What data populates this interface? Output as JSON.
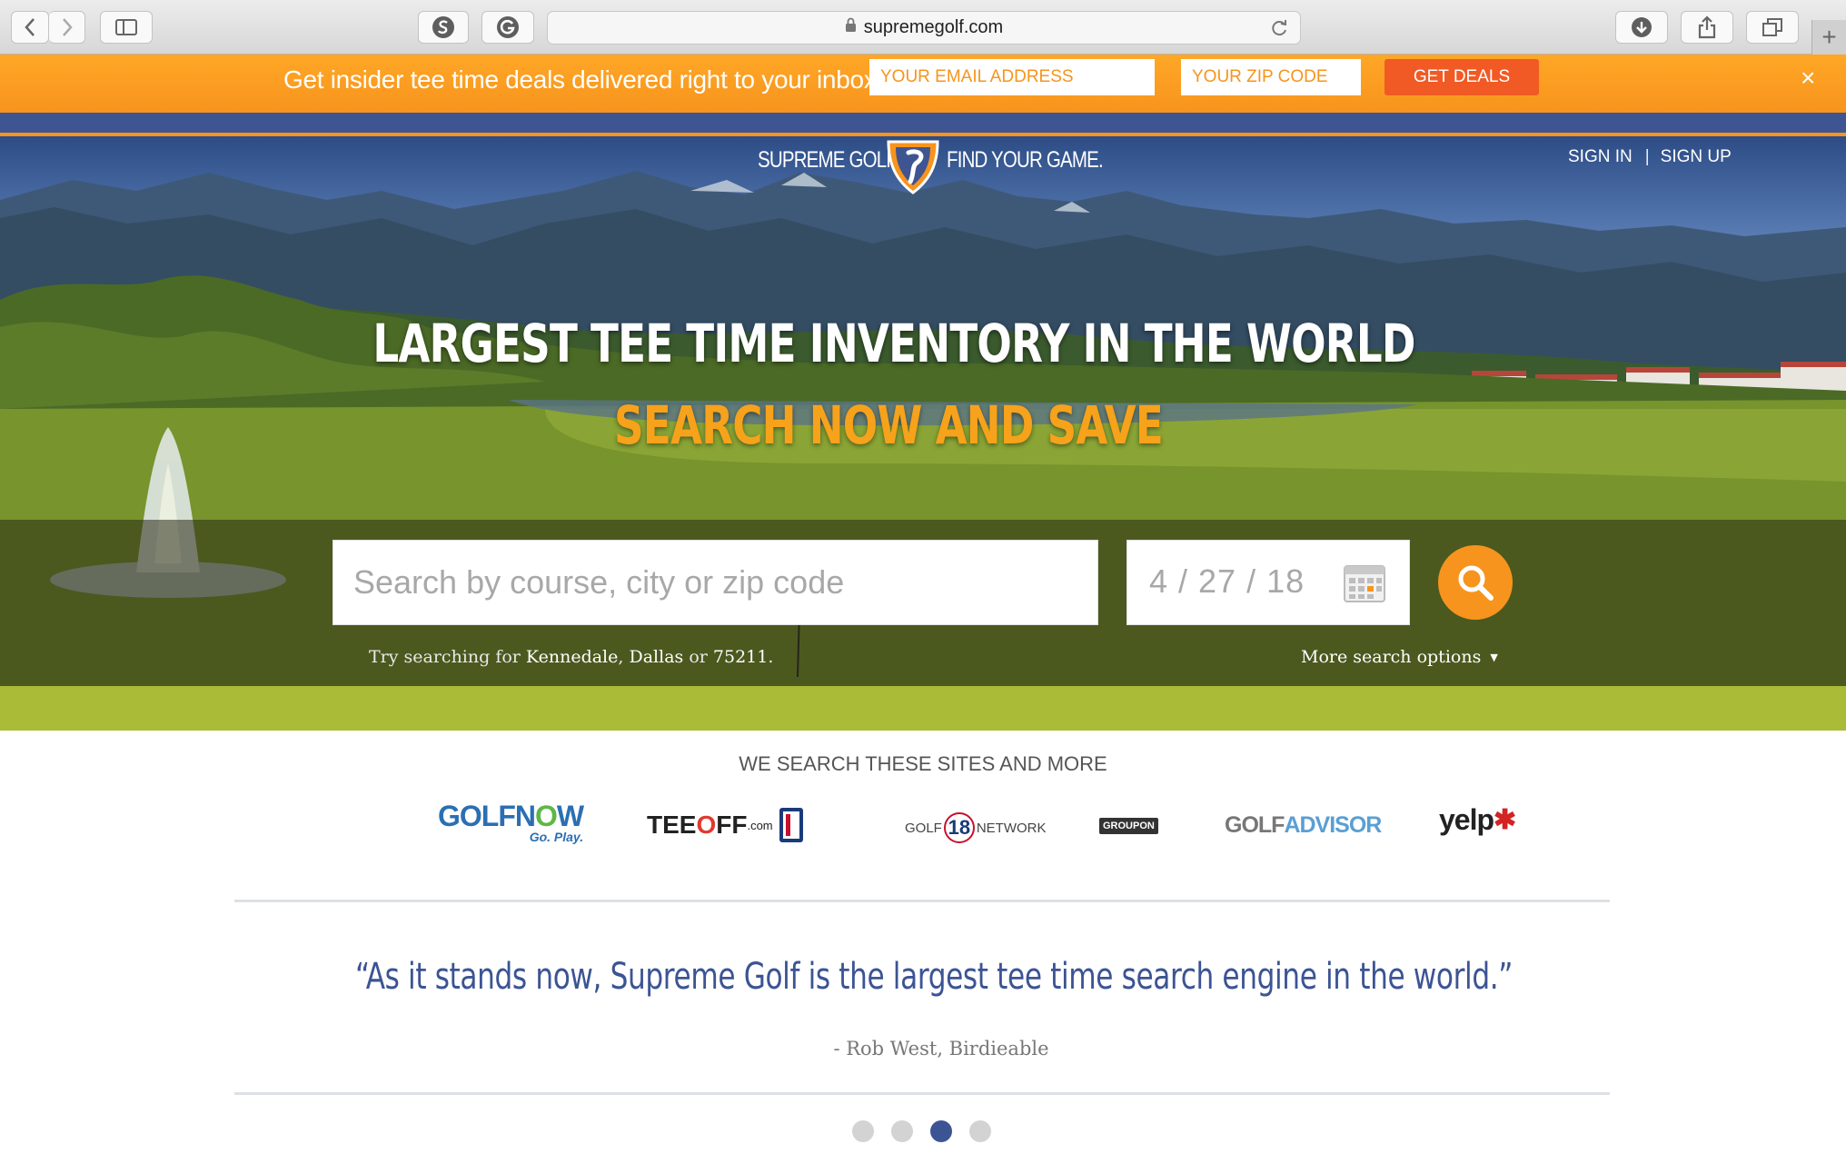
{
  "browser": {
    "url": "supremegolf.com"
  },
  "promo": {
    "text": "Get insider tee time deals delivered right to your inbox!",
    "email_placeholder": "YOUR EMAIL ADDRESS",
    "zip_placeholder": "YOUR ZIP CODE",
    "button_label": "GET DEALS",
    "close_glyph": "×"
  },
  "header": {
    "brand_left": "SUPREME GOLF",
    "brand_right": "FIND YOUR GAME.",
    "sign_in": "SIGN IN",
    "separator": "|",
    "sign_up": "SIGN UP"
  },
  "hero": {
    "title": "LARGEST TEE TIME INVENTORY IN THE WORLD",
    "subtitle": "SEARCH NOW AND SAVE",
    "search_placeholder": "Search by course, city or zip code",
    "date_value": "4 / 27 / 18",
    "hint_prefix": "Try searching for ",
    "hint_items": [
      "Kennedale",
      "Dallas",
      "75211"
    ],
    "hint_joiners": [
      ", ",
      " or ",
      "."
    ],
    "more_options": "More search options"
  },
  "partners": {
    "heading": "WE SEARCH THESE SITES AND MORE",
    "logos": {
      "golfnow_a": "GOLFN",
      "golfnow_b": "O",
      "golfnow_c": "W",
      "golfnow_tag": "Go. Play.",
      "teeoff_a": "TEE",
      "teeoff_o": "O",
      "teeoff_b": "FF",
      "teeoff_com": ".com",
      "golf18_a": "GOLF",
      "golf18_num": "18",
      "golf18_b": "NETWORK",
      "groupon": "GROUPON",
      "golfadvisor_a": "GOLF",
      "golfadvisor_b": "ADVISOR",
      "yelp": "yelp"
    }
  },
  "testimonial": {
    "quote": "“As it stands now, Supreme Golf is the largest tee time search engine in the world.”",
    "author": "- Rob West, Birdieable",
    "dots": 4,
    "active_dot": 3
  },
  "colors": {
    "orange": "#f7941d",
    "navy": "#3e5592",
    "quote_blue": "#3c5494"
  }
}
